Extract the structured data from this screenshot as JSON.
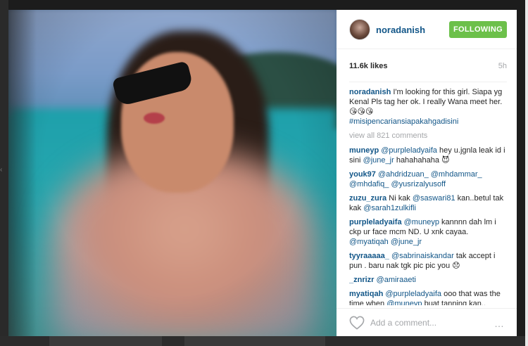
{
  "post": {
    "username": "noradanish",
    "follow_label": "FOLLOWING",
    "likes": "11.6k likes",
    "time": "5h",
    "view_all": "view all 821 comments",
    "add_comment_placeholder": "Add a comment...",
    "more_label": "…"
  },
  "caption": {
    "user": "noradanish",
    "text": " I'm looking for this girl. Siapa yg Kenal Pls tag her ok. I really Wana meet her. ",
    "emoji": "😘😘😘",
    "hashtag": "#misipencariansiapakahgadisini"
  },
  "comments": [
    {
      "user": "muneyp",
      "mention": "@purpleladyaifa",
      "text": " hey u.jgnla leak id i sini ",
      "mention2": "@june_jr",
      "text2": " hahahahaha ",
      "emoji": "😈"
    },
    {
      "user": "youk97",
      "mention": "@ahdridzuan_",
      "text": " ",
      "mention2": "@mhdammar_",
      "text2": " ",
      "mention3": "@mhdafiq_",
      "text3": " ",
      "mention4": "@yusrizalyusoff"
    },
    {
      "user": "zuzu_zura",
      "text": " Ni kak ",
      "mention": "@saswari81",
      "text2": " kan..betul tak kak ",
      "mention2": "@sarah1zulkifli"
    },
    {
      "user": "purpleladyaifa",
      "mention": "@muneyp",
      "text": " kannnn dah lm i ckp ur face mcm ND. U xnk cayaa. ",
      "mention2": "@myatiqah",
      "text2": " ",
      "mention3": "@june_jr"
    },
    {
      "user": "tyyraaaaa_",
      "mention": "@sabrinaiskandar",
      "text": " tak accept i pun . baru nak tgk pic pic you ",
      "emoji": "😞"
    },
    {
      "user": "_znrizr",
      "mention": "@amiraaeti"
    },
    {
      "user": "myatiqah",
      "mention": "@purpleladyaifa",
      "text": " ooo that was the time when ",
      "mention2": "@muneyp",
      "text2": " buat tanning kan.."
    }
  ],
  "colors": {
    "follow_green": "#6cc04a",
    "link_blue": "#125688",
    "muted_gray": "#a5a7aa"
  },
  "icons": {
    "like": "heart-outline-icon",
    "more": "ellipsis-icon"
  }
}
